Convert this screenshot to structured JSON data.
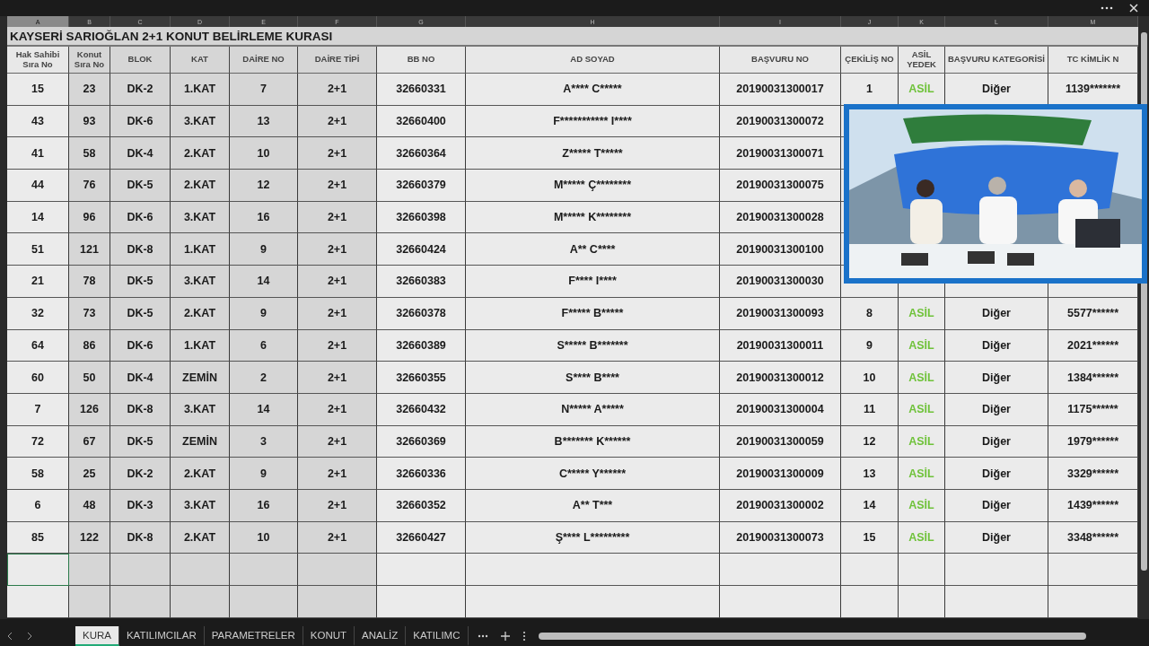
{
  "column_letters": [
    "A",
    "B",
    "C",
    "D",
    "E",
    "F",
    "G",
    "H",
    "I",
    "J",
    "K",
    "L",
    "M"
  ],
  "sheet_title": "KAYSERİ SARIOĞLAN 2+1 KONUT BELİRLEME KURASI",
  "headers": [
    "Hak Sahibi Sıra No",
    "Konut Sıra No",
    "BLOK",
    "KAT",
    "DAİRE NO",
    "DAİRE TİPİ",
    "BB NO",
    "AD SOYAD",
    "BAŞVURU NO",
    "ÇEKİLİŞ NO",
    "ASİL YEDEK",
    "BAŞVURU KATEGORİSİ",
    "TC KİMLİK N"
  ],
  "rows": [
    {
      "cells": [
        "15",
        "23",
        "DK-2",
        "1.KAT",
        "7",
        "2+1",
        "32660331",
        "A**** C*****",
        "20190031300017",
        "1",
        "ASİL",
        "Diğer",
        "1139*******"
      ]
    },
    {
      "cells": [
        "43",
        "93",
        "DK-6",
        "3.KAT",
        "13",
        "2+1",
        "32660400",
        "F*********** I****",
        "20190031300072"
      ]
    },
    {
      "cells": [
        "41",
        "58",
        "DK-4",
        "2.KAT",
        "10",
        "2+1",
        "32660364",
        "Z***** T*****",
        "20190031300071"
      ]
    },
    {
      "cells": [
        "44",
        "76",
        "DK-5",
        "2.KAT",
        "12",
        "2+1",
        "32660379",
        "M***** Ç********",
        "20190031300075"
      ]
    },
    {
      "cells": [
        "14",
        "96",
        "DK-6",
        "3.KAT",
        "16",
        "2+1",
        "32660398",
        "M***** K********",
        "20190031300028"
      ]
    },
    {
      "cells": [
        "51",
        "121",
        "DK-8",
        "1.KAT",
        "9",
        "2+1",
        "32660424",
        "A** C****",
        "20190031300100"
      ]
    },
    {
      "cells": [
        "21",
        "78",
        "DK-5",
        "3.KAT",
        "14",
        "2+1",
        "32660383",
        "F**** I****",
        "20190031300030"
      ]
    },
    {
      "cells": [
        "32",
        "73",
        "DK-5",
        "2.KAT",
        "9",
        "2+1",
        "32660378",
        "F***** B*****",
        "20190031300093",
        "8",
        "ASİL",
        "Diğer",
        "5577******"
      ]
    },
    {
      "cells": [
        "64",
        "86",
        "DK-6",
        "1.KAT",
        "6",
        "2+1",
        "32660389",
        "S***** B*******",
        "20190031300011",
        "9",
        "ASİL",
        "Diğer",
        "2021******"
      ]
    },
    {
      "cells": [
        "60",
        "50",
        "DK-4",
        "ZEMİN",
        "2",
        "2+1",
        "32660355",
        "S**** B****",
        "20190031300012",
        "10",
        "ASİL",
        "Diğer",
        "1384******"
      ]
    },
    {
      "cells": [
        "7",
        "126",
        "DK-8",
        "3.KAT",
        "14",
        "2+1",
        "32660432",
        "N***** A*****",
        "20190031300004",
        "11",
        "ASİL",
        "Diğer",
        "1175******"
      ]
    },
    {
      "cells": [
        "72",
        "67",
        "DK-5",
        "ZEMİN",
        "3",
        "2+1",
        "32660369",
        "B******* K******",
        "20190031300059",
        "12",
        "ASİL",
        "Diğer",
        "1979******"
      ]
    },
    {
      "cells": [
        "58",
        "25",
        "DK-2",
        "2.KAT",
        "9",
        "2+1",
        "32660336",
        "C***** Y******",
        "20190031300009",
        "13",
        "ASİL",
        "Diğer",
        "3329******"
      ]
    },
    {
      "cells": [
        "6",
        "48",
        "DK-3",
        "3.KAT",
        "16",
        "2+1",
        "32660352",
        "A** T***",
        "20190031300002",
        "14",
        "ASİL",
        "Diğer",
        "1439******"
      ]
    },
    {
      "cells": [
        "85",
        "122",
        "DK-8",
        "2.KAT",
        "10",
        "2+1",
        "32660427",
        "Ş**** L*********",
        "20190031300073",
        "15",
        "ASİL",
        "Diğer",
        "3348******"
      ]
    }
  ],
  "sheet_tabs": [
    {
      "label": "KURA",
      "selected": true
    },
    {
      "label": "KATILIMCILAR",
      "selected": false
    },
    {
      "label": "PARAMETRELER",
      "selected": false
    },
    {
      "label": "KONUT",
      "selected": false
    },
    {
      "label": "ANALİZ",
      "selected": false
    },
    {
      "label": "KATILIMC",
      "selected": false
    }
  ]
}
